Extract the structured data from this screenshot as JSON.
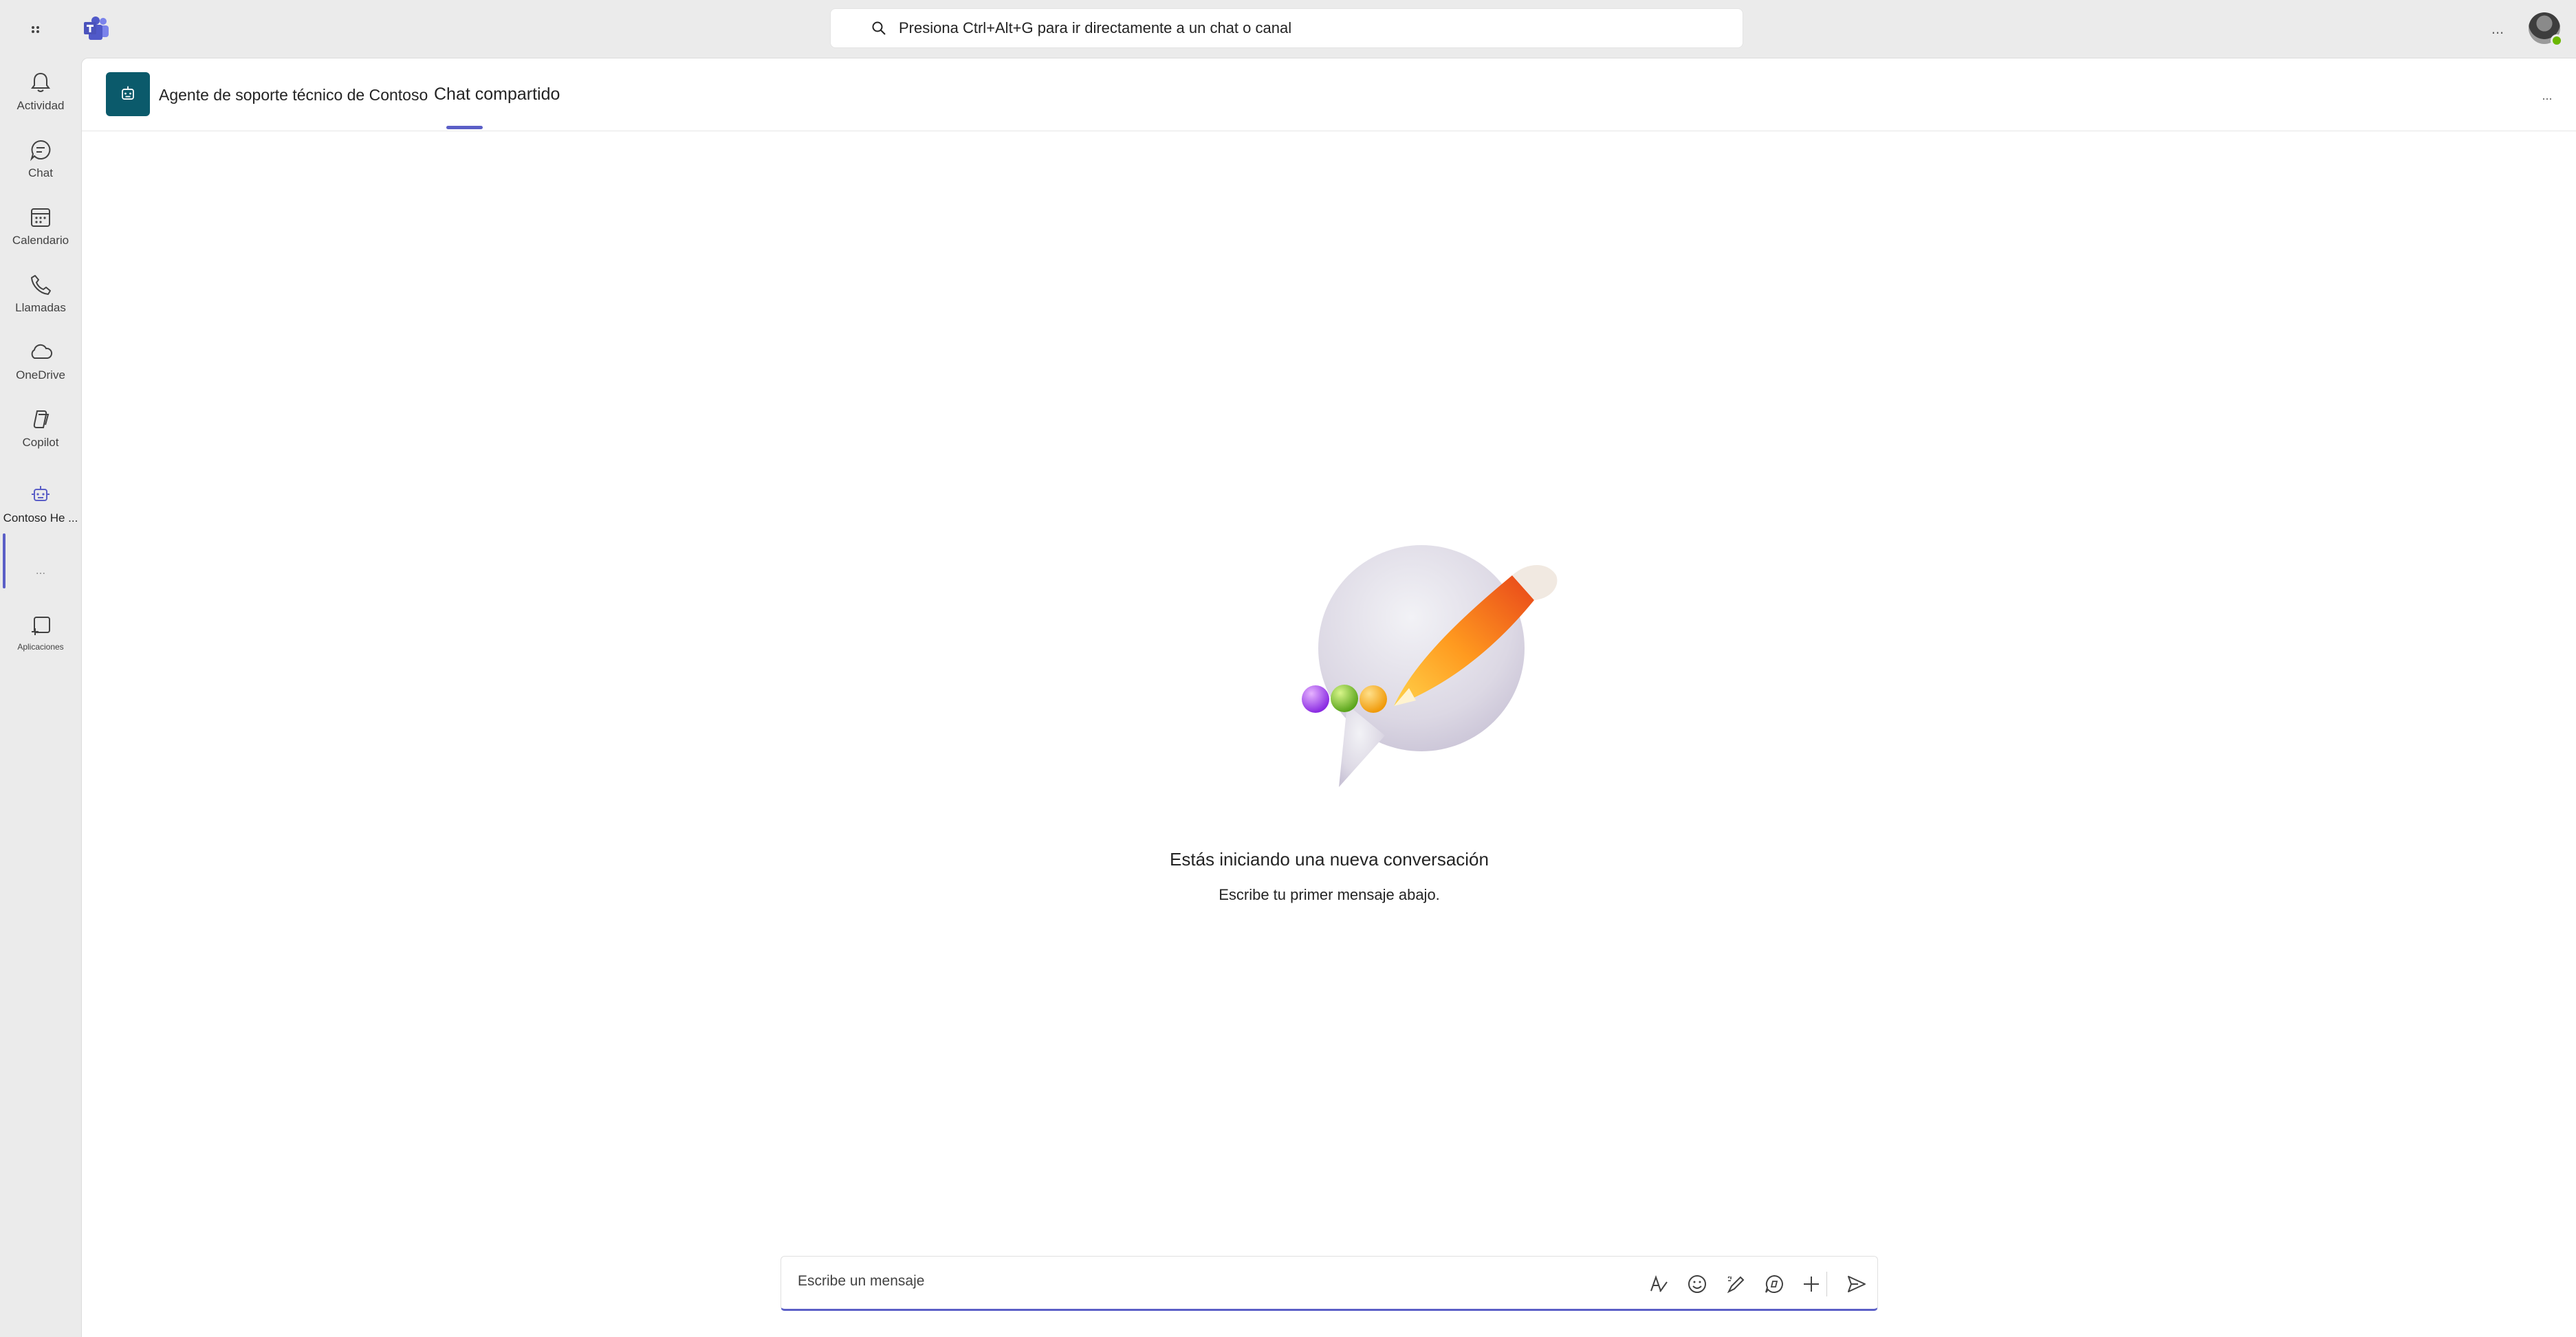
{
  "search": {
    "placeholder": "Presiona Ctrl+Alt+G para ir directamente a un chat o canal"
  },
  "topbar": {
    "more_label": "..."
  },
  "rail": {
    "items": [
      {
        "label": "Actividad",
        "icon": "bell-icon"
      },
      {
        "label": "Chat",
        "icon": "chat-icon"
      },
      {
        "label": "Calendario",
        "icon": "calendar-icon"
      },
      {
        "label": "Llamadas",
        "icon": "phone-icon"
      },
      {
        "label": "OneDrive",
        "icon": "cloud-icon"
      },
      {
        "label": "Copilot",
        "icon": "copilot-icon"
      },
      {
        "label": "Contoso He ...",
        "icon": "bot-icon"
      },
      {
        "label": "...",
        "icon": "more-icon"
      },
      {
        "label": "Aplicaciones",
        "icon": "add-app-icon"
      }
    ]
  },
  "header": {
    "bot_name": "Agente de soporte técnico de Contoso",
    "tab_label": "Chat compartido",
    "more_label": "..."
  },
  "empty_state": {
    "title": "Estás iniciando una nueva conversación",
    "subtitle": "Escribe tu primer mensaje abajo."
  },
  "composer": {
    "placeholder": "Escribe un mensaje",
    "tools": [
      "format-icon",
      "emoji-icon",
      "loop-icon",
      "copilot-chat-icon",
      "plus-icon",
      "send-icon"
    ]
  },
  "colors": {
    "accent": "#5b5fc7",
    "bot_avatar": "#0b5a6b",
    "presence": "#6bb700"
  }
}
